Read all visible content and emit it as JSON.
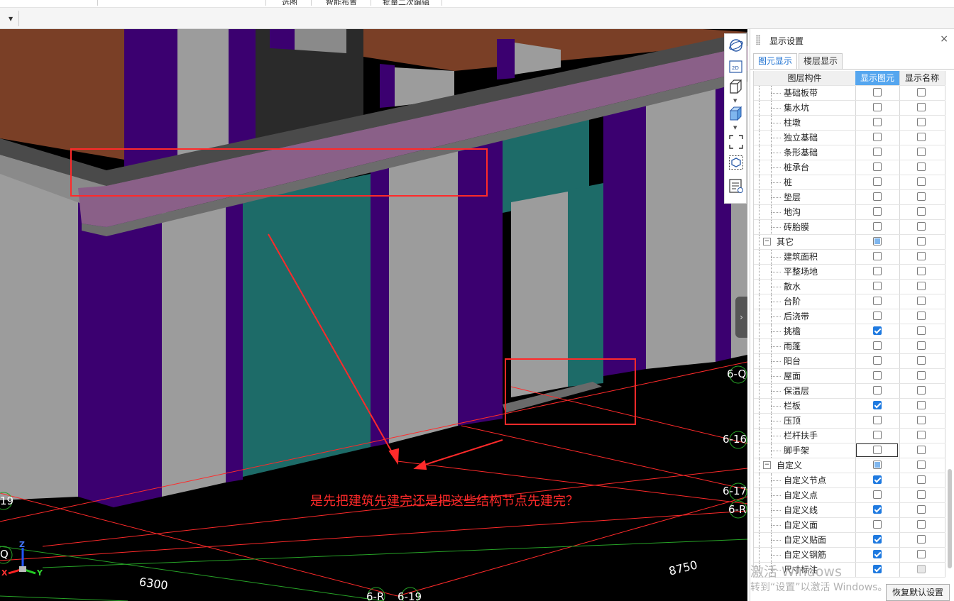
{
  "top_tabs": [
    "选图",
    "智能布置",
    "批量二次编辑"
  ],
  "viewport": {
    "annotation": "是先把建筑先建完还是把这些结构节点先建完？",
    "axis_labels": {
      "q1": "6-Q",
      "a16": "6-16",
      "a17": "6-17",
      "r1": "6-R",
      "a19": "19",
      "q2": "Q",
      "r2": "6-R",
      "b19": "6-19"
    },
    "dimensions": {
      "d1": "6300",
      "d2": "8750"
    },
    "triad": {
      "x": "X",
      "y": "Y",
      "z": "Z"
    },
    "colors": {
      "wall_gray": "#9a9a9a",
      "column_purple": "#3b0070",
      "teal": "#1d6b68",
      "slab_brown": "#7a3f26",
      "beam_pink": "#8a6088",
      "annotation_red": "#ff2a2a"
    }
  },
  "view_toolbar": [
    "orbit-icon",
    "2d-view-icon",
    "3d-box-icon",
    "3d-solid-box-icon",
    "full-screen-icon",
    "box-select-icon",
    "display-settings-icon"
  ],
  "panel": {
    "title": "显示设置",
    "close": "×",
    "tabs": [
      "图元显示",
      "楼层显示"
    ],
    "columns": [
      "图层构件",
      "显示图元",
      "显示名称"
    ],
    "rows": [
      {
        "label": "基础板带",
        "show": "off",
        "name": "off",
        "type": "child"
      },
      {
        "label": "集水坑",
        "show": "off",
        "name": "off",
        "type": "child"
      },
      {
        "label": "柱墩",
        "show": "off",
        "name": "off",
        "type": "child"
      },
      {
        "label": "独立基础",
        "show": "off",
        "name": "off",
        "type": "child"
      },
      {
        "label": "条形基础",
        "show": "off",
        "name": "off",
        "type": "child"
      },
      {
        "label": "桩承台",
        "show": "off",
        "name": "off",
        "type": "child"
      },
      {
        "label": "桩",
        "show": "off",
        "name": "off",
        "type": "child"
      },
      {
        "label": "垫层",
        "show": "off",
        "name": "off",
        "type": "child"
      },
      {
        "label": "地沟",
        "show": "off",
        "name": "off",
        "type": "child"
      },
      {
        "label": "砖胎膜",
        "show": "off",
        "name": "off",
        "type": "child"
      },
      {
        "label": "其它",
        "show": "part",
        "name": "off",
        "type": "group"
      },
      {
        "label": "建筑面积",
        "show": "off",
        "name": "off",
        "type": "child"
      },
      {
        "label": "平整场地",
        "show": "off",
        "name": "off",
        "type": "child"
      },
      {
        "label": "散水",
        "show": "off",
        "name": "off",
        "type": "child"
      },
      {
        "label": "台阶",
        "show": "off",
        "name": "off",
        "type": "child"
      },
      {
        "label": "后浇带",
        "show": "off",
        "name": "off",
        "type": "child"
      },
      {
        "label": "挑檐",
        "show": "on",
        "name": "off",
        "type": "child"
      },
      {
        "label": "雨蓬",
        "show": "off",
        "name": "off",
        "type": "child"
      },
      {
        "label": "阳台",
        "show": "off",
        "name": "off",
        "type": "child"
      },
      {
        "label": "屋面",
        "show": "off",
        "name": "off",
        "type": "child"
      },
      {
        "label": "保温层",
        "show": "off",
        "name": "off",
        "type": "child"
      },
      {
        "label": "栏板",
        "show": "on",
        "name": "off",
        "type": "child"
      },
      {
        "label": "压顶",
        "show": "off",
        "name": "off",
        "type": "child"
      },
      {
        "label": "栏杆扶手",
        "show": "off",
        "name": "off",
        "type": "child"
      },
      {
        "label": "脚手架",
        "show": "off",
        "name": "off",
        "type": "child",
        "focus": true
      },
      {
        "label": "自定义",
        "show": "part",
        "name": "off",
        "type": "group"
      },
      {
        "label": "自定义节点",
        "show": "on",
        "name": "off",
        "type": "child"
      },
      {
        "label": "自定义点",
        "show": "off",
        "name": "off",
        "type": "child"
      },
      {
        "label": "自定义线",
        "show": "on",
        "name": "off",
        "type": "child"
      },
      {
        "label": "自定义面",
        "show": "off",
        "name": "off",
        "type": "child"
      },
      {
        "label": "自定义贴面",
        "show": "on",
        "name": "off",
        "type": "child"
      },
      {
        "label": "自定义钢筋",
        "show": "on",
        "name": "off",
        "type": "child"
      },
      {
        "label": "尺寸标注",
        "show": "on",
        "name": "disabled",
        "type": "child"
      }
    ],
    "restore_button": "恢复默认设置"
  },
  "watermark": {
    "line1": "激活 Windows",
    "line2": "转到“设置”以激活 Windows。"
  }
}
